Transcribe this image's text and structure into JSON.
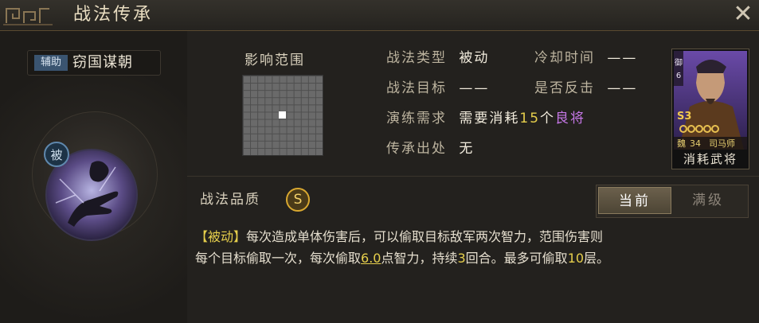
{
  "window": {
    "title": "战法传承",
    "close_icon": "close-icon"
  },
  "skill": {
    "role_badge": "辅助",
    "name": "窃国谋朝",
    "type_badge": "被",
    "icon": "dark-hand-skill-icon"
  },
  "range": {
    "title": "影响范围",
    "grid_size": 11,
    "self_cell": [
      5,
      5
    ]
  },
  "info": {
    "type_label": "战法类型",
    "type_value": "被动",
    "cooldown_label": "冷却时间",
    "cooldown_value": "——",
    "target_label": "战法目标",
    "target_value": "——",
    "counter_label": "是否反击",
    "counter_value": "——",
    "train_label": "演练需求",
    "train_prefix": "需要消耗",
    "train_count": "15",
    "train_unit": "个",
    "train_item": "良将",
    "origin_label": "传承出处",
    "origin_value": "无"
  },
  "card": {
    "label": "消耗武将",
    "side_text": "御",
    "side_num": "6",
    "rank": "S3",
    "faction": "魏",
    "level": "34",
    "name": "司马师"
  },
  "quality": {
    "label": "战法品质",
    "value": "S"
  },
  "tabs": {
    "current": "当前",
    "max": "满级"
  },
  "description": {
    "tag": "【被动】",
    "line1": "每次造成单体伤害后，可以偷取目标敌军两次智力，范围伤害则",
    "line2a": "每个目标偷取一次，每次偷取",
    "value": "6.0",
    "line2b": "点智力，持续",
    "turns": "3",
    "line2c": "回合。最多可偷取",
    "max_layers": "10",
    "line2d": "层。"
  },
  "colors": {
    "accent_yellow": "#e6cf4c",
    "accent_purple": "#c577e6",
    "passive_blue": "#5f88ad"
  }
}
